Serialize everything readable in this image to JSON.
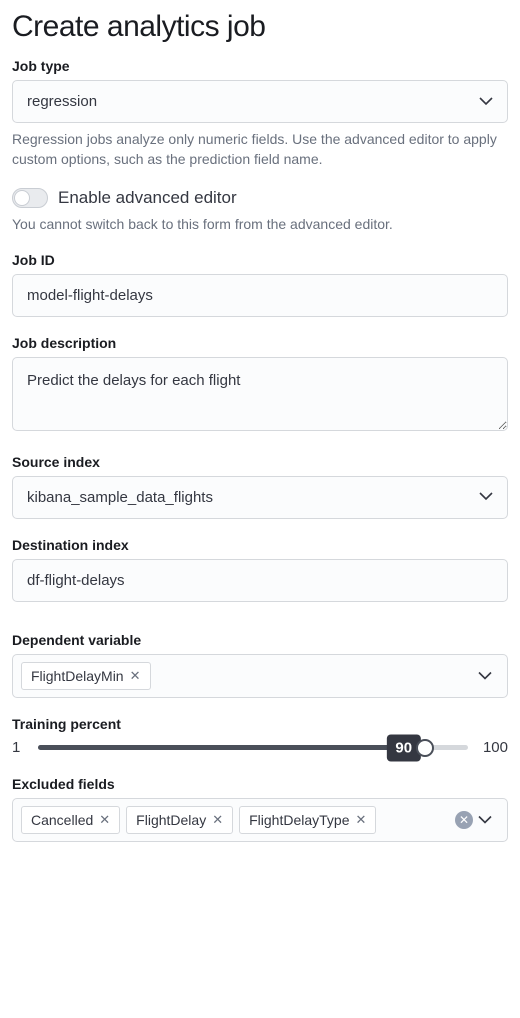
{
  "title": "Create analytics job",
  "jobType": {
    "label": "Job type",
    "value": "regression",
    "help": "Regression jobs analyze only numeric fields. Use the advanced editor to apply custom options, such as the prediction field name."
  },
  "advancedEditor": {
    "label": "Enable advanced editor",
    "help": "You cannot switch back to this form from the advanced editor.",
    "enabled": false
  },
  "jobId": {
    "label": "Job ID",
    "value": "model-flight-delays"
  },
  "jobDescription": {
    "label": "Job description",
    "value": "Predict the delays for each flight"
  },
  "sourceIndex": {
    "label": "Source index",
    "value": "kibana_sample_data_flights"
  },
  "destinationIndex": {
    "label": "Destination index",
    "value": "df-flight-delays"
  },
  "dependentVariable": {
    "label": "Dependent variable",
    "pills": [
      "FlightDelayMin"
    ]
  },
  "trainingPercent": {
    "label": "Training percent",
    "min": "1",
    "max": "100",
    "value": "90"
  },
  "excludedFields": {
    "label": "Excluded fields",
    "pills": [
      "Cancelled",
      "FlightDelay",
      "FlightDelayType"
    ]
  }
}
